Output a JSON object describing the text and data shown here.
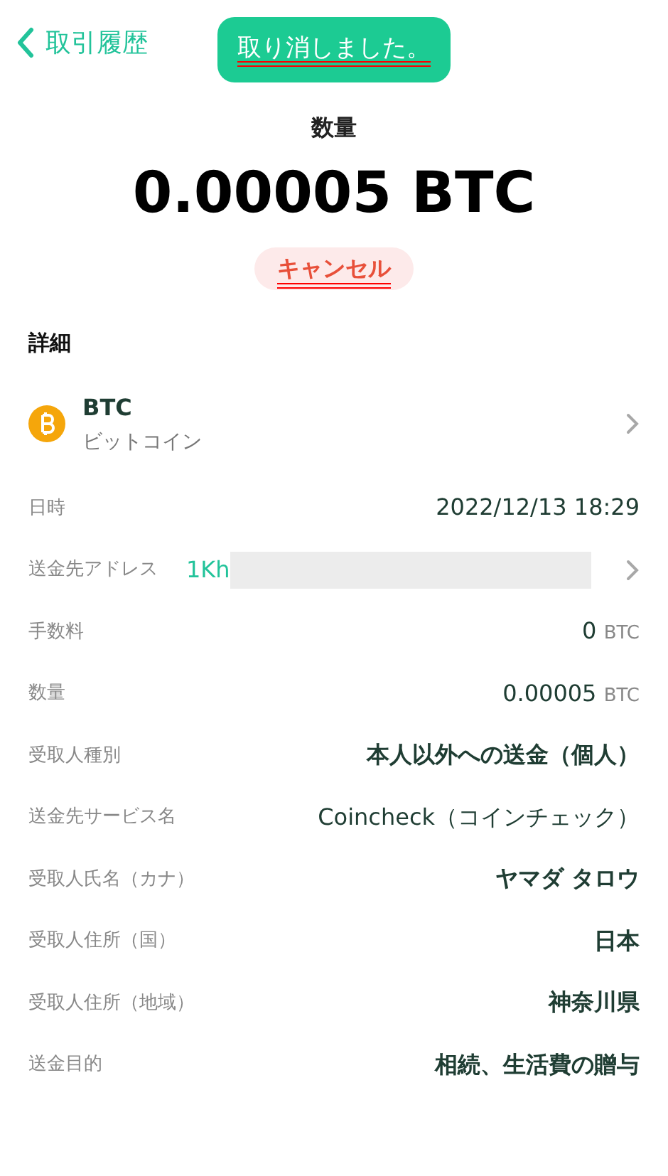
{
  "header": {
    "back_label": "取引履歴"
  },
  "toast": {
    "text": "取り消しました。"
  },
  "summary": {
    "label": "数量",
    "amount": "0.00005 BTC",
    "status": "キャンセル"
  },
  "details": {
    "title": "詳細",
    "asset": {
      "symbol": "BTC",
      "name": "ビットコイン"
    },
    "rows": [
      {
        "kind": "text",
        "label": "日時",
        "value": "2022/12/13 18:29"
      },
      {
        "kind": "address",
        "label": "送金先アドレス",
        "value": "1Kh"
      },
      {
        "kind": "amount",
        "label": "手数料",
        "value": "0",
        "unit": "BTC"
      },
      {
        "kind": "amount",
        "label": "数量",
        "value": "0.00005",
        "unit": "BTC"
      },
      {
        "kind": "strong",
        "label": "受取人種別",
        "value": "本人以外への送金（個人）"
      },
      {
        "kind": "text",
        "label": "送金先サービス名",
        "value": "Coincheck（コインチェック）"
      },
      {
        "kind": "strong",
        "label": "受取人氏名（カナ）",
        "value": "ヤマダ タロウ"
      },
      {
        "kind": "strong",
        "label": "受取人住所（国）",
        "value": "日本"
      },
      {
        "kind": "strong",
        "label": "受取人住所（地域）",
        "value": "神奈川県"
      },
      {
        "kind": "strong",
        "label": "送金目的",
        "value": "相続、生活費の贈与"
      }
    ]
  }
}
